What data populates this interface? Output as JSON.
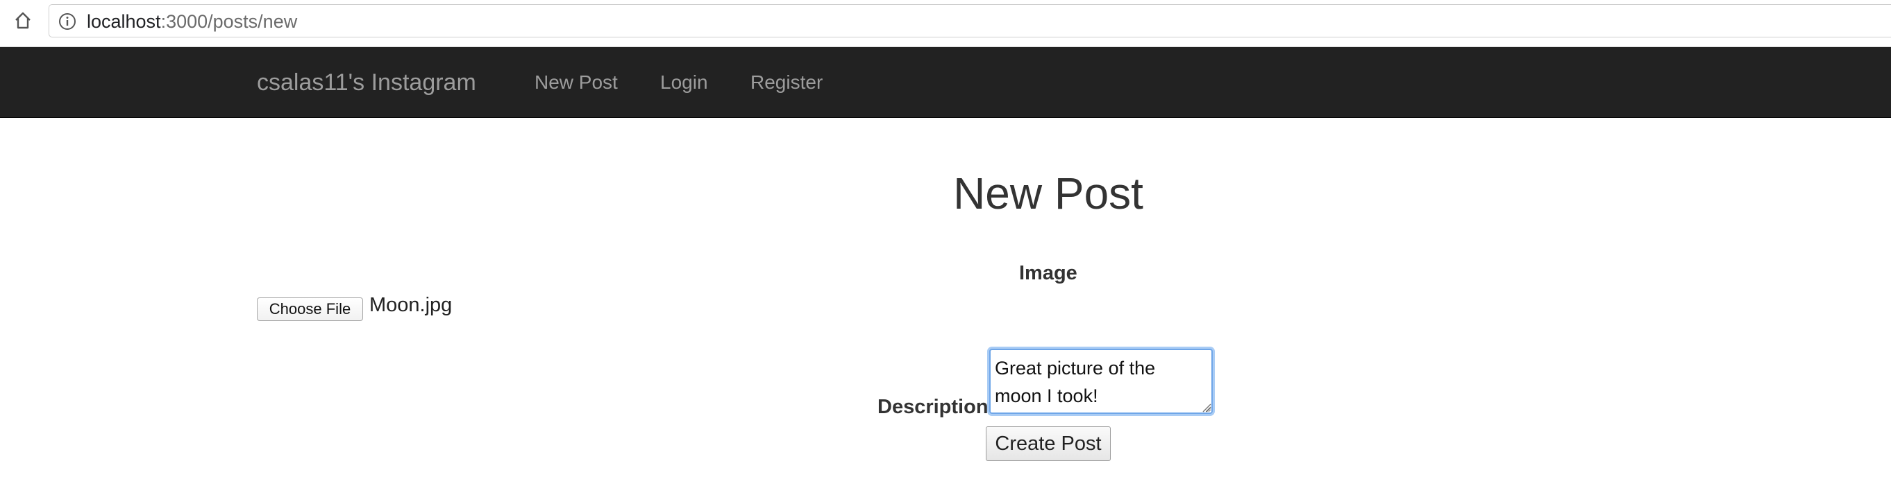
{
  "browser": {
    "url_host": "localhost",
    "url_path": ":3000/posts/new"
  },
  "navbar": {
    "brand": "csalas11's Instagram",
    "links": [
      "New Post",
      "Login",
      "Register"
    ]
  },
  "main": {
    "title": "New Post",
    "image_label": "Image",
    "file_button_label": "Choose File",
    "file_name": "Moon.jpg",
    "description_label": "Description",
    "description_value": "Great picture of the moon I took!",
    "submit_label": "Create Post"
  },
  "colors": {
    "navbar_bg": "#222222",
    "navbar_text": "#9d9d9d",
    "focus_ring": "#6fa6e8"
  },
  "icons": [
    "home-icon",
    "info-icon",
    "resize-grip-icon"
  ]
}
